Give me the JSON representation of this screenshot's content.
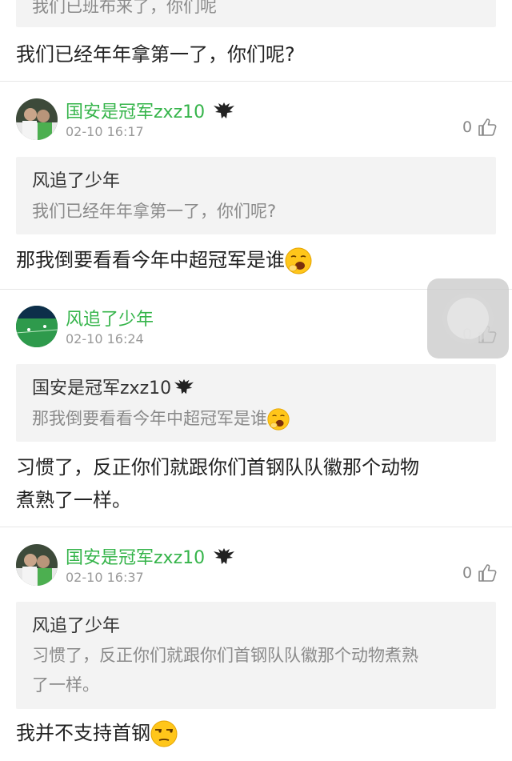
{
  "top": {
    "quote_text_partial": "我们已班布来了，你们呢",
    "reply": "我们已经年年拿第一了，你们呢?"
  },
  "comments": [
    {
      "user": "国安是冠军zxz10",
      "time": "02-10 16:17",
      "likes": "0",
      "quote_author": "风追了少年",
      "quote_text": "我们已经年年拿第一了，你们呢?",
      "reply": "那我倒要看看今年中超冠军是谁",
      "reply_emoji": "yawning-face-emoji"
    },
    {
      "user": "风追了少年",
      "time": "02-10 16:24",
      "likes": "0",
      "quote_author": "国安是冠军zxz10",
      "quote_text": "那我倒要看看今年中超冠军是谁",
      "reply_line1": "习惯了，反正你们就跟你们首钢队队徽那个动物",
      "reply_line2": "煮熟了一样。"
    },
    {
      "user": "国安是冠军zxz10",
      "time": "02-10 16:37",
      "likes": "0",
      "quote_author": "风追了少年",
      "quote_line1": "习惯了，反正你们就跟你们首钢队队徽那个动物煮熟",
      "quote_line2": "了一样。",
      "reply": "我并不支持首钢",
      "reply_emoji": "unamused-face-emoji"
    }
  ],
  "icons": {
    "like": "thumbs-up-icon",
    "badge": "eagle-badge-icon",
    "floating": "assistive-touch-button"
  },
  "colors": {
    "username": "#35b44a",
    "quote_bg": "#f3f3f3",
    "muted": "#999999"
  }
}
